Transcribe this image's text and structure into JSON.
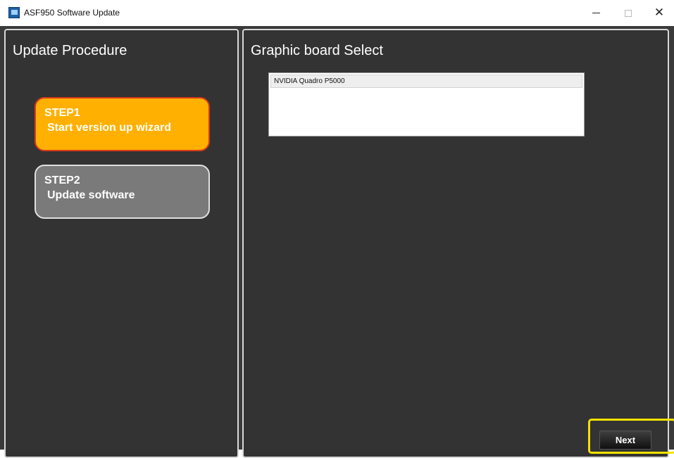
{
  "window": {
    "title": "ASF950 Software Update",
    "icon": "app-icon",
    "controls": {
      "minimize": "minimize-icon",
      "maximize": "maximize-icon",
      "close": "close-icon"
    }
  },
  "left_panel": {
    "title": "Update Procedure",
    "steps": [
      {
        "title": "STEP1",
        "description": "Start version up wizard",
        "state": "active",
        "color": "#ffb000"
      },
      {
        "title": "STEP2",
        "description": "Update software",
        "state": "inactive",
        "color": "#7a7a7a"
      }
    ]
  },
  "right_panel": {
    "title": "Graphic board Select",
    "boards": [
      "NVIDIA Quadro P5000"
    ]
  },
  "footer": {
    "next_label": "Next",
    "highlight_color": "#f2e200"
  }
}
